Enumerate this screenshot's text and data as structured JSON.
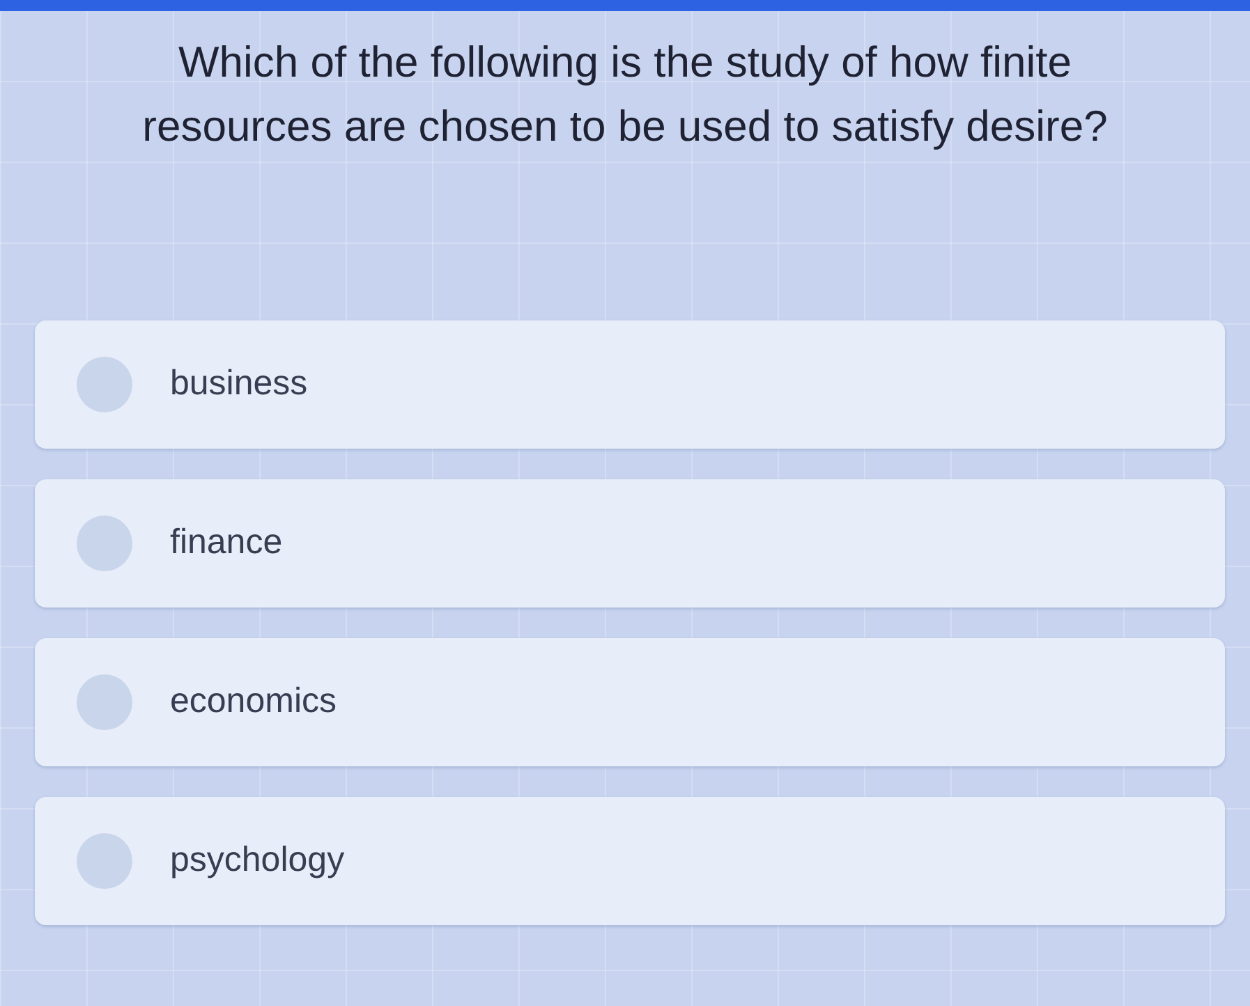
{
  "question": {
    "text": "Which of the following is the study of how finite resources are chosen to be used to satisfy desire?"
  },
  "options": [
    {
      "label": "business",
      "selected": false
    },
    {
      "label": "finance",
      "selected": false
    },
    {
      "label": "economics",
      "selected": false
    },
    {
      "label": "psychology",
      "selected": false
    }
  ]
}
